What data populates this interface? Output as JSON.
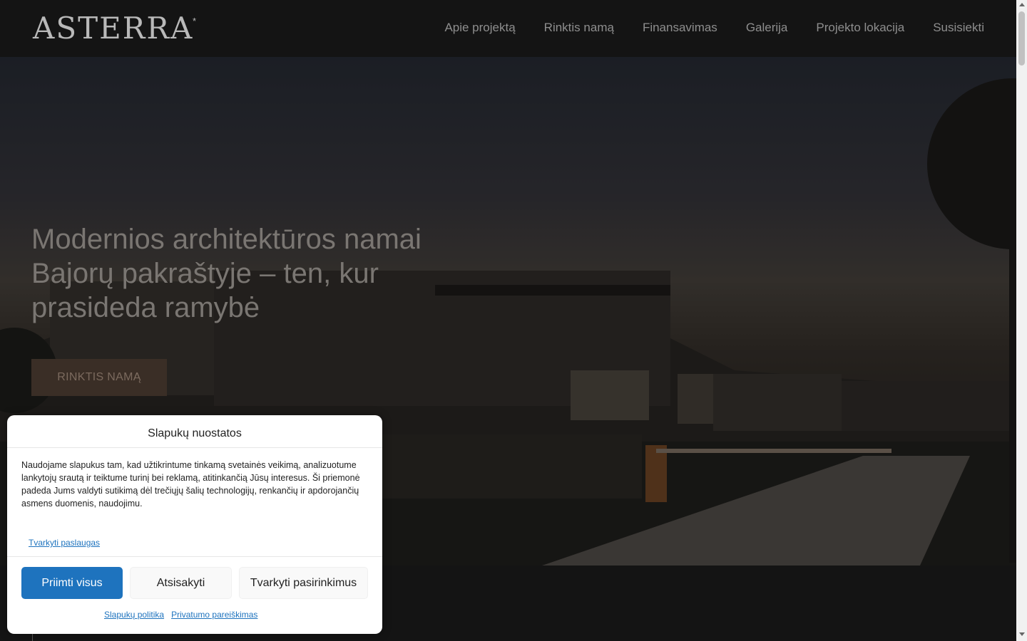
{
  "header": {
    "logo": "ASTERRA",
    "logo_mark": "*",
    "nav": [
      "Apie projektą",
      "Rinktis namą",
      "Finansavimas",
      "Galerija",
      "Projekto lokacija",
      "Susisiekti"
    ]
  },
  "hero": {
    "title": "Modernios architektūros namai Bajorų pakraštyje – ten, kur prasideda ramybė",
    "button": "RINKTIS NAMĄ"
  },
  "cookie_banner": {
    "title": "Slapukų nuostatos",
    "body": "Naudojame slapukus tam, kad užtikrintume tinkamą svetainės veikimą, analizuotume lankytojų srautą ir teiktume turinį bei reklamą, atitinkančią Jūsų interesus. Ši priemonė padeda Jums valdyti sutikimą dėl trečiųjų šalių technologijų, renkančių ir apdorojančių asmens duomenis, naudojimu.",
    "manage_services": "Tvarkyti paslaugas",
    "accept_all": "Priimti visus",
    "deny": "Atsisakyti",
    "manage_preferences": "Tvarkyti pasirinkimus",
    "cookie_policy": "Slapukų politika",
    "privacy_statement": "Privatumo pareiškimas"
  },
  "colors": {
    "accent": "#1e73be",
    "header_bg": "#141414",
    "hero_button_bg": "#3a2e26"
  },
  "icons": {
    "scroll_up": "triangle-up",
    "scroll_down": "triangle-down"
  }
}
